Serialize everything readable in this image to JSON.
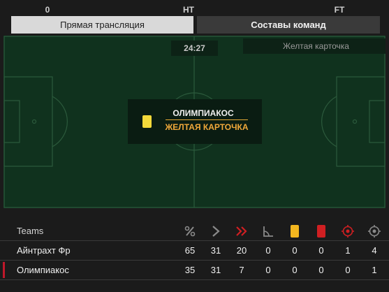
{
  "timeline": {
    "start": "0",
    "half": "HT",
    "end": "FT"
  },
  "tabs": {
    "live": "Прямая трансляция",
    "lineups": "Составы команд"
  },
  "pitch": {
    "clock": "24:27",
    "last_event": "Желтая карточка",
    "event_team": "ОЛИМПИАКОС",
    "event_type": "ЖЕЛТАЯ КАРТОЧКА"
  },
  "stats": {
    "teams_label": "Teams",
    "icons": [
      "possession-icon",
      "attacks-icon",
      "dangerous-attacks-icon",
      "corners-icon",
      "yellow-card-icon",
      "red-card-icon",
      "shots-on-target-icon",
      "shots-off-target-icon"
    ],
    "rows": [
      {
        "team": "Айнтрахт Фр",
        "bar_color": "#1b1b1b",
        "values": [
          "65",
          "31",
          "20",
          "0",
          "0",
          "0",
          "1",
          "4"
        ]
      },
      {
        "team": "Олимпиакос",
        "bar_color": "#c0182a",
        "values": [
          "35",
          "31",
          "7",
          "0",
          "0",
          "0",
          "0",
          "1"
        ]
      }
    ]
  },
  "colors": {
    "pitch": "#10321e",
    "accent_orange": "#f0a83a",
    "yellow_card": "#f3d93a",
    "red_card": "#d01f22"
  }
}
